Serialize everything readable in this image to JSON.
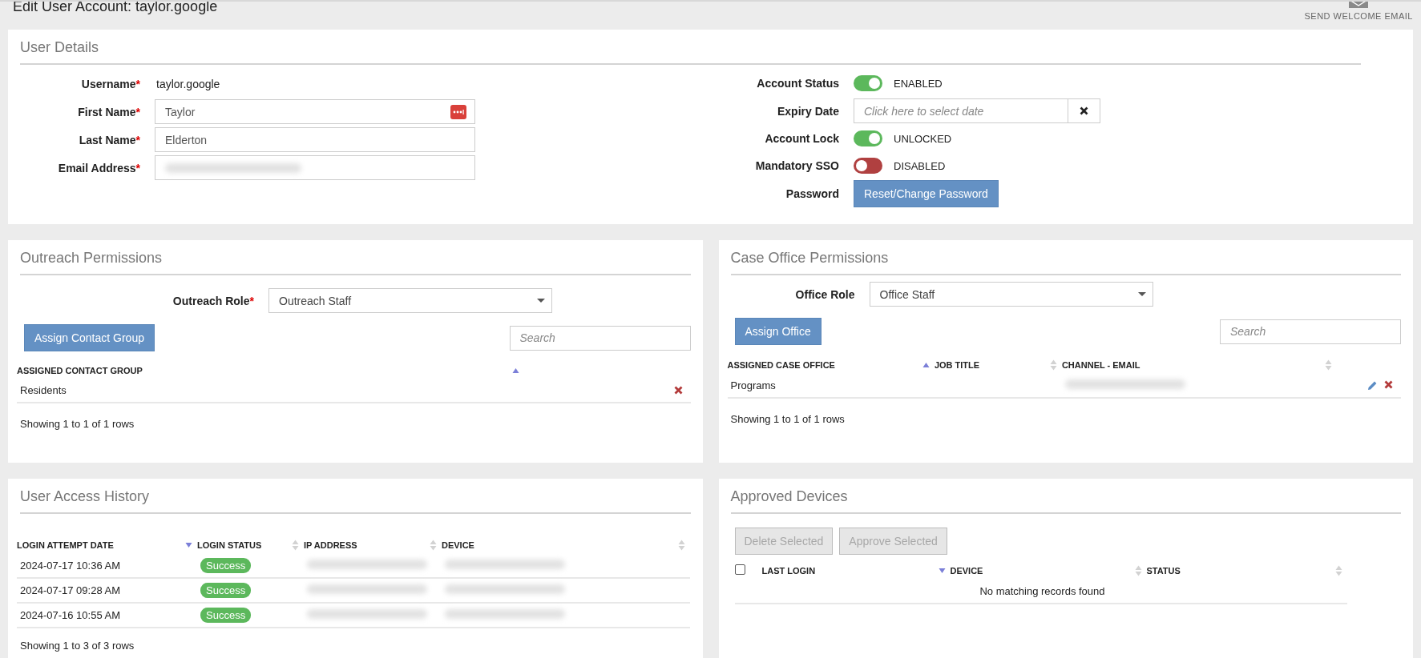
{
  "page": {
    "title": "Edit User Account: taylor.google",
    "action": "SEND WELCOME EMAIL"
  },
  "user_details": {
    "title": "User Details",
    "left_fields": [
      {
        "kind": "text",
        "label": "Username",
        "required_mark": "*",
        "value": "taylor.google"
      },
      {
        "kind": "input",
        "label": "First Name",
        "required_mark": "*",
        "value": "Taylor",
        "password_manager": true
      },
      {
        "kind": "input",
        "label": "Last Name",
        "required_mark": "*",
        "value": "Elderton"
      },
      {
        "kind": "redacted",
        "label": "Email Address",
        "required_mark": "*"
      }
    ],
    "right_fields": [
      {
        "kind": "toggle",
        "label": "Account Status",
        "on": true,
        "state_text": "ENABLED"
      },
      {
        "kind": "date",
        "label": "Expiry Date",
        "placeholder": "Click here to select date"
      },
      {
        "kind": "toggle",
        "label": "Account Lock",
        "on": true,
        "state_text": "UNLOCKED"
      },
      {
        "kind": "toggle",
        "label": "Mandatory SSO",
        "on": false,
        "state_text": "DISABLED"
      },
      {
        "kind": "button",
        "label": "Password",
        "button": "Reset/Change Password"
      }
    ]
  },
  "outreach": {
    "title": "Outreach Permissions",
    "role": {
      "label": "Outreach Role",
      "required_mark": "*",
      "value": "Outreach Staff"
    },
    "button": "Assign Contact Group",
    "search": {
      "placeholder": "Search"
    },
    "columns": [
      {
        "kind": "data",
        "label": "ASSIGNED CONTACT GROUP",
        "sorted": true,
        "descending": false
      },
      {
        "kind": "actions"
      }
    ],
    "rows": [
      [
        {
          "kind": "text",
          "text": "Residents"
        },
        {
          "kind": "actions",
          "delete": true
        }
      ]
    ],
    "footer": "Showing 1 to 1 of 1 rows"
  },
  "case_office": {
    "title": "Case Office Permissions",
    "role": {
      "label": "Office Role",
      "value": "Office Staff"
    },
    "button": "Assign Office",
    "search": {
      "placeholder": "Search"
    },
    "columns": [
      {
        "kind": "data",
        "label": "ASSIGNED CASE OFFICE",
        "sorted": true,
        "descending": false
      },
      {
        "kind": "data",
        "label": "JOB TITLE",
        "sorted": false,
        "descending": false
      },
      {
        "kind": "data",
        "label": "CHANNEL - EMAIL",
        "sorted": false,
        "descending": false
      },
      {
        "kind": "actions"
      }
    ],
    "rows": [
      [
        {
          "kind": "text",
          "text": "Programs"
        },
        {
          "kind": "empty"
        },
        {
          "kind": "redacted"
        },
        {
          "kind": "actions",
          "edit": true,
          "delete": true
        }
      ]
    ],
    "footer": "Showing 1 to 1 of 1 rows"
  },
  "access_history": {
    "title": "User Access History",
    "columns": [
      {
        "kind": "data",
        "label": "LOGIN ATTEMPT DATE",
        "sorted": true,
        "descending": true
      },
      {
        "kind": "data",
        "label": "LOGIN STATUS",
        "sorted": false,
        "descending": false
      },
      {
        "kind": "data",
        "label": "IP ADDRESS",
        "sorted": false,
        "descending": false
      },
      {
        "kind": "data",
        "label": "DEVICE",
        "sorted": false,
        "descending": false
      }
    ],
    "rows": [
      [
        {
          "kind": "text",
          "text": "2024-07-17 10:36 AM"
        },
        {
          "kind": "badge",
          "text": "Success"
        },
        {
          "kind": "redacted"
        },
        {
          "kind": "redacted"
        }
      ],
      [
        {
          "kind": "text",
          "text": "2024-07-17 09:28 AM"
        },
        {
          "kind": "badge",
          "text": "Success"
        },
        {
          "kind": "redacted"
        },
        {
          "kind": "redacted"
        }
      ],
      [
        {
          "kind": "text",
          "text": "2024-07-16 10:55 AM"
        },
        {
          "kind": "badge",
          "text": "Success"
        },
        {
          "kind": "redacted"
        },
        {
          "kind": "redacted"
        }
      ]
    ],
    "footer": "Showing 1 to 3 of 3 rows"
  },
  "approved_devices": {
    "title": "Approved Devices",
    "buttons": [
      {
        "label": "Delete Selected",
        "disabled": true
      },
      {
        "label": "Approve Selected",
        "disabled": true
      }
    ],
    "select_all": {
      "checked": false
    },
    "columns": [
      {
        "kind": "data",
        "label": "LAST LOGIN",
        "sorted": true,
        "descending": true
      },
      {
        "kind": "data",
        "label": "DEVICE",
        "sorted": false,
        "descending": false
      },
      {
        "kind": "data",
        "label": "STATUS",
        "sorted": false,
        "descending": false
      }
    ],
    "empty_message": "No matching records found"
  }
}
